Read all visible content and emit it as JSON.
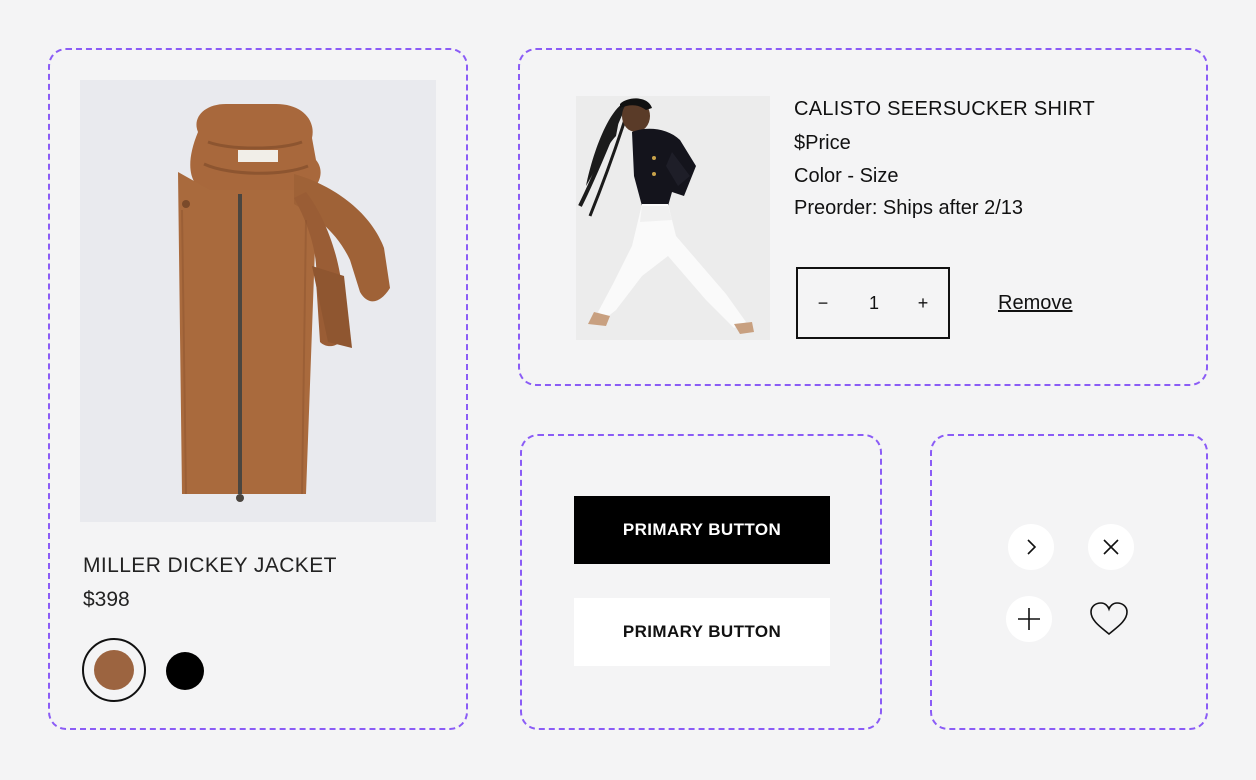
{
  "product_card": {
    "image_alt": "Miller Dickey Jacket in camel knit",
    "name": "MILLER DICKEY JACKET",
    "price": "$398",
    "swatches": [
      {
        "name": "camel",
        "color": "#9c6440",
        "selected": true
      },
      {
        "name": "black",
        "color": "#000000",
        "selected": false
      }
    ]
  },
  "cart_item": {
    "image_alt": "Model wearing black blazer and white flared pants",
    "title": "CALISTO SEERSUCKER SHIRT",
    "price": "$Price",
    "variant": "Color - Size",
    "preorder": "Preorder: Ships after 2/13",
    "quantity": {
      "decrement": "−",
      "value": "1",
      "increment": "+"
    },
    "remove_label": "Remove"
  },
  "buttons": {
    "primary_dark_label": "PRIMARY BUTTON",
    "primary_light_label": "PRIMARY BUTTON"
  },
  "icons": [
    "chevron-right-icon",
    "close-icon",
    "plus-icon",
    "heart-icon"
  ],
  "colors": {
    "accent_dashed": "#8b5cf6",
    "background": "#f4f4f5",
    "button_dark": "#000000",
    "button_light": "#ffffff"
  }
}
